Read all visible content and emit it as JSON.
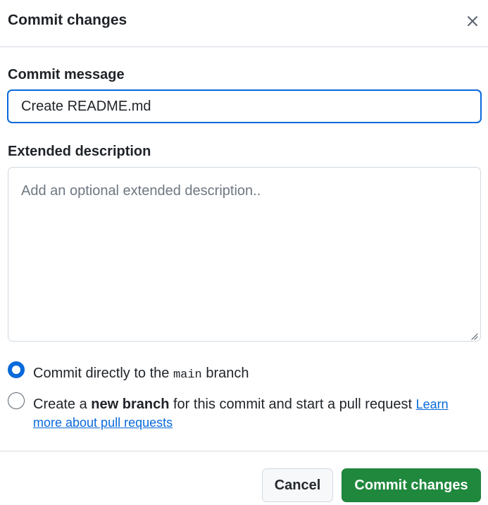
{
  "dialog": {
    "title": "Commit changes",
    "close_icon": "close-icon"
  },
  "commit_message": {
    "label": "Commit message",
    "value": "Create README.md"
  },
  "extended_description": {
    "label": "Extended description",
    "placeholder": "Add an optional extended description.."
  },
  "branch_options": {
    "direct": {
      "selected": true,
      "prefix": "Commit directly to the",
      "branch": "main",
      "suffix": "branch"
    },
    "new_branch": {
      "selected": false,
      "prefix": "Create a",
      "bold": "new branch",
      "suffix": "for this commit and start a pull request",
      "link_part1": "Learn",
      "link_part2": "more about pull requests"
    }
  },
  "buttons": {
    "cancel": "Cancel",
    "commit": "Commit changes"
  },
  "colors": {
    "accent": "#0969da",
    "primary_button": "#1f883d"
  }
}
